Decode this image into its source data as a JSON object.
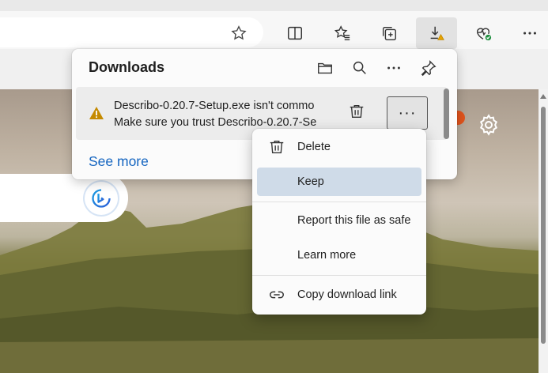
{
  "toolbar": {
    "buttons": [
      {
        "name": "favorite-star-icon"
      },
      {
        "name": "split-screen-icon"
      },
      {
        "name": "favorites-icon"
      },
      {
        "name": "collections-icon"
      },
      {
        "name": "downloads-warning-icon"
      },
      {
        "name": "browser-essentials-icon"
      },
      {
        "name": "more-options-icon"
      }
    ]
  },
  "downloads": {
    "title": "Downloads",
    "header_icons": [
      "open-folder-icon",
      "search-icon",
      "more-icon",
      "pin-icon"
    ],
    "item": {
      "line1": "Describo-0.20.7-Setup.exe isn't commo",
      "line2": "Make sure you trust Describo-0.20.7-Se",
      "more_label": "···"
    },
    "see_more": "See more"
  },
  "context_menu": {
    "items": [
      {
        "label": "Delete",
        "icon": "trash-icon"
      },
      {
        "label": "Keep",
        "highlighted": true
      },
      {
        "label": "Report this file as safe"
      },
      {
        "label": "Learn more"
      },
      {
        "label": "Copy download link",
        "icon": "link-icon"
      }
    ]
  },
  "colors": {
    "accent": "#1565c0",
    "highlight": "#cfdbe8",
    "warning": "#c58a00"
  }
}
